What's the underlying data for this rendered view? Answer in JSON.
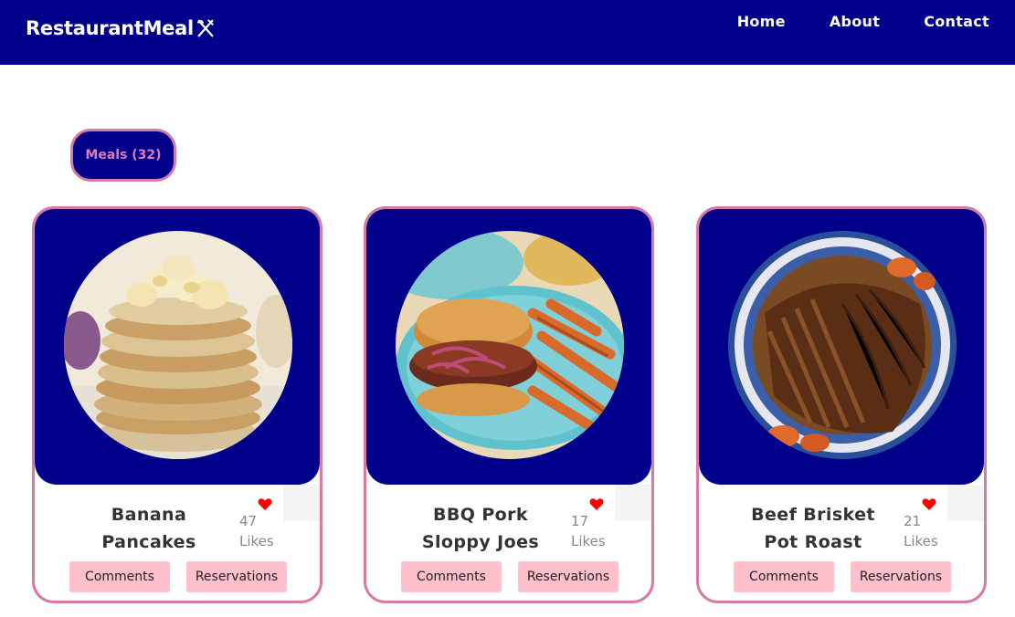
{
  "brand": {
    "name": "RestaurantMeal",
    "icon": "fork-knife-icon"
  },
  "nav": {
    "home": "Home",
    "about": "About",
    "contact": "Contact"
  },
  "meals_tab": {
    "label": "Meals (32)"
  },
  "colors": {
    "navy": "#00008b",
    "pink_border": "#d67aa6",
    "button_pink": "#ffc0cb",
    "heart_red": "#ff0000"
  },
  "cards": [
    {
      "name": "Banana Pancakes",
      "likes": "47",
      "likes_label": "Likes",
      "comments": "Comments",
      "reservations": "Reservations",
      "image": "banana-pancakes-image"
    },
    {
      "name": "BBQ Pork Sloppy Joes",
      "likes": "17",
      "likes_label": "Likes",
      "comments": "Comments",
      "reservations": "Reservations",
      "image": "bbq-sloppy-joes-image"
    },
    {
      "name": "Beef Brisket Pot Roast",
      "likes": "21",
      "likes_label": "Likes",
      "comments": "Comments",
      "reservations": "Reservations",
      "image": "beef-brisket-image"
    }
  ]
}
